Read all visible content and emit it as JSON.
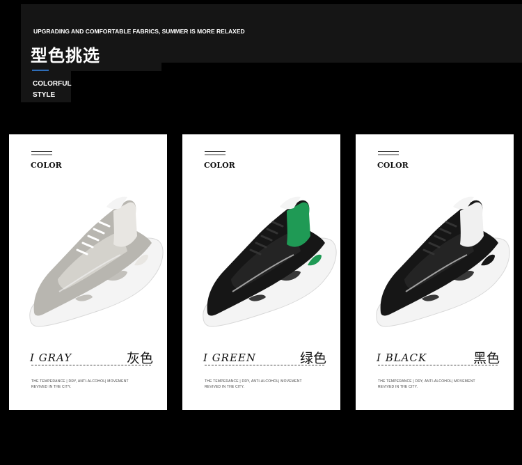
{
  "header": {
    "subheading": "UPGRADING AND COMFORTABLE FABRICS, SUMMER IS MORE RELAXED",
    "title": "型色挑选",
    "style_line1": "COLORFUL",
    "style_line2": "STYLE"
  },
  "cards": [
    {
      "color_label": "COLOR",
      "name_en": "I GRAY",
      "name_cn": "灰色",
      "desc_line1": "THE TEMPERANCE | DRY, ANTI-ALCOHOL| MOVEMENT",
      "desc_line2": "REVIVED IN THE CITY.",
      "colors": {
        "upper": "#b8b6b0",
        "mesh": "#d7d5cf",
        "accent": "#e8e6e2",
        "sole": "#f4f4f4",
        "lace": "#f0f0f0"
      }
    },
    {
      "color_label": "COLOR",
      "name_en": "I GREEN",
      "name_cn": "绿色",
      "desc_line1": "THE TEMPERANCE | DRY, ANTI-ALCOHOL| MOVEMENT",
      "desc_line2": "REVIVED IN THE CITY.",
      "colors": {
        "upper": "#161616",
        "mesh": "#262626",
        "accent": "#1f9a55",
        "sole": "#f4f4f4",
        "lace": "#1a1a1a"
      }
    },
    {
      "color_label": "COLOR",
      "name_en": "I BLACK",
      "name_cn": "黑色",
      "desc_line1": "THE TEMPERANCE | DRY, ANTI-ALCOHOL| MOVEMENT",
      "desc_line2": "REVIVED IN THE CITY.",
      "colors": {
        "upper": "#161616",
        "mesh": "#262626",
        "accent": "#f0f0f0",
        "sole": "#f4f4f4",
        "lace": "#1a1a1a"
      }
    }
  ]
}
